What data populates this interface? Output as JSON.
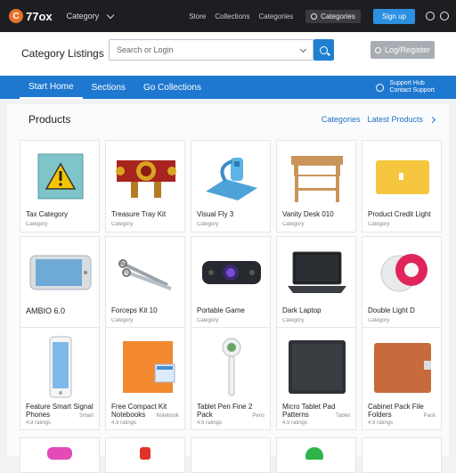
{
  "topbar": {
    "logo_mark": "C",
    "logo_text": "77ox",
    "dropdown_label": "Category",
    "links": [
      "Store",
      "Collections",
      "Categories"
    ],
    "search_label": "Categories",
    "blue_button": "Sign up"
  },
  "header": {
    "title": "Category Listings",
    "search_placeholder": "Search or Login",
    "right_button": "Log/Register"
  },
  "nav": {
    "items": [
      "Start Home",
      "Sections",
      "Go Collections"
    ],
    "right_line1": "Support Hub",
    "right_line2": "Contact Support"
  },
  "section": {
    "title": "Products",
    "link1": "Categories",
    "link2": "Latest Products"
  },
  "cards": [
    {
      "name": "Tax Category",
      "meta": "Category"
    },
    {
      "name": "Treasure Tray Kit",
      "meta": "Category"
    },
    {
      "name": "Visual Fly 3",
      "meta": "Category"
    },
    {
      "name": "Vanity Desk 010",
      "meta": "Category"
    },
    {
      "name": "Product Credit Light",
      "meta": "Category"
    },
    {
      "name": "AMBIO 6.0",
      "meta": ""
    },
    {
      "name": "Forceps Kit 10",
      "meta": "Category"
    },
    {
      "name": "Portable Game",
      "meta": "Category"
    },
    {
      "name": "Dark Laptop",
      "meta": "Category"
    },
    {
      "name": "Double Light D",
      "meta": "Category"
    },
    {
      "name": "Feature Smart Signal Phones",
      "meta": "4.9 ratings",
      "side": "Smart"
    },
    {
      "name": "Free Compact Kit Notebooks",
      "meta": "4.9 ratings",
      "side": "Notebook"
    },
    {
      "name": "Tablet Pen Fine 2 Pack",
      "meta": "4.9 ratings",
      "side": "Pens"
    },
    {
      "name": "Micro Tablet Pad Patterns",
      "meta": "4.9 ratings",
      "side": "Tablet"
    },
    {
      "name": "Cabinet Pack File Folders",
      "meta": "4.9 ratings",
      "side": "Pack"
    }
  ]
}
